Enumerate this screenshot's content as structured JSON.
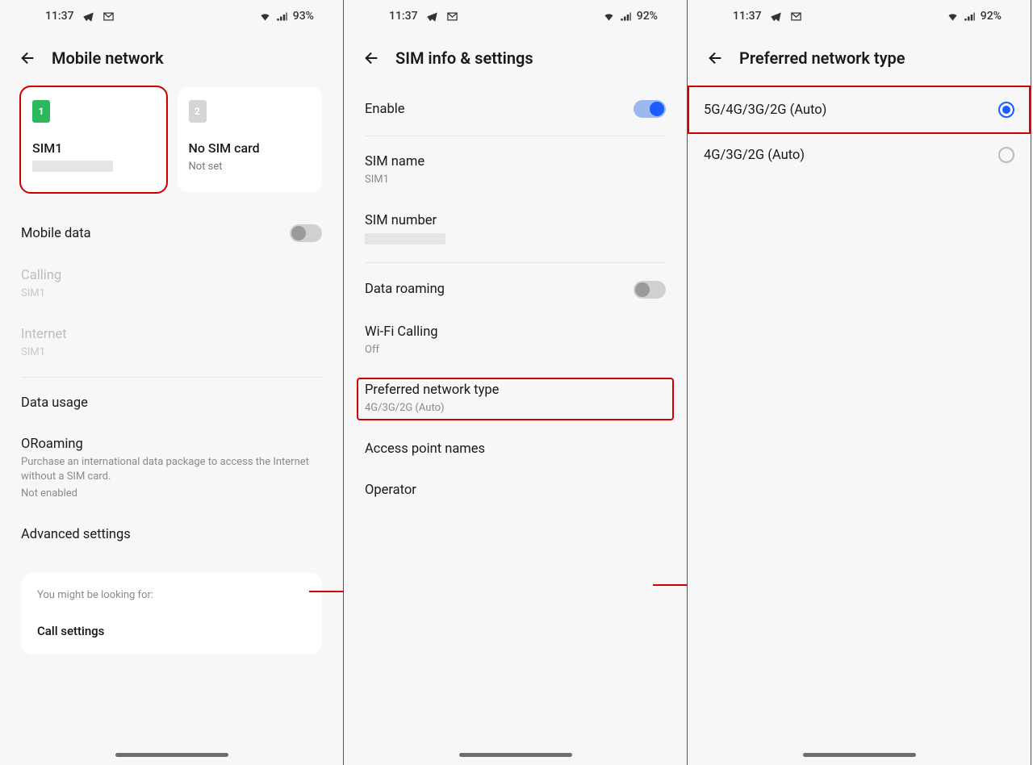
{
  "screen1": {
    "status": {
      "time": "11:37",
      "battery": "93%"
    },
    "title": "Mobile network",
    "sim1": {
      "chip": "1",
      "name": "SIM1"
    },
    "sim2": {
      "chip": "2",
      "name": "No SIM card",
      "sub": "Not set"
    },
    "mobile_data": "Mobile data",
    "calling": {
      "title": "Calling",
      "sub": "SIM1"
    },
    "internet": {
      "title": "Internet",
      "sub": "SIM1"
    },
    "data_usage": "Data usage",
    "oroaming": {
      "title": "ORoaming",
      "desc": "Purchase an international data package to access the Internet without a SIM card.",
      "status": "Not enabled"
    },
    "advanced": "Advanced settings",
    "hint": {
      "label": "You might be looking for:",
      "item": "Call settings"
    }
  },
  "screen2": {
    "status": {
      "time": "11:37",
      "battery": "92%"
    },
    "title": "SIM info & settings",
    "enable": "Enable",
    "sim_name": {
      "title": "SIM name",
      "sub": "SIM1"
    },
    "sim_number": "SIM number",
    "data_roaming": "Data roaming",
    "wifi_calling": {
      "title": "Wi-Fi Calling",
      "sub": "Off"
    },
    "pnt": {
      "title": "Preferred network type",
      "sub": "4G/3G/2G (Auto)"
    },
    "apn": "Access point names",
    "operator": "Operator"
  },
  "screen3": {
    "status": {
      "time": "11:37",
      "battery": "92%"
    },
    "title": "Preferred network type",
    "opt1": "5G/4G/3G/2G (Auto)",
    "opt2": "4G/3G/2G (Auto)"
  }
}
